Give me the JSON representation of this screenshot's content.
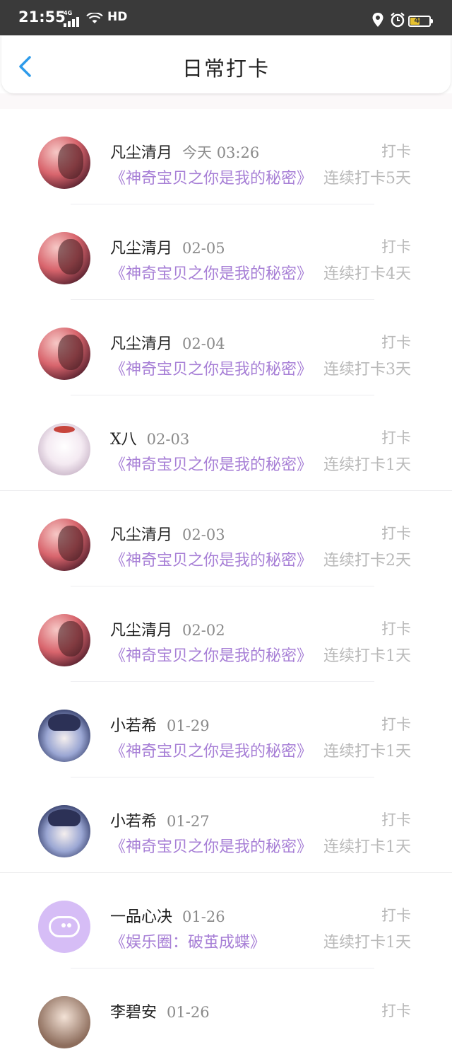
{
  "status_bar": {
    "time": "21:55",
    "network": "4G",
    "network_label": "HD",
    "battery": "47"
  },
  "header": {
    "title": "日常打卡"
  },
  "checkins": [
    {
      "user": "凡尘清月",
      "date": "今天 03:26",
      "action": "打卡",
      "topic": "《神奇宝贝之你是我的秘密》",
      "streak": "连续打卡5天"
    },
    {
      "user": "凡尘清月",
      "date": "02-05",
      "action": "打卡",
      "topic": "《神奇宝贝之你是我的秘密》",
      "streak": "连续打卡4天"
    },
    {
      "user": "凡尘清月",
      "date": "02-04",
      "action": "打卡",
      "topic": "《神奇宝贝之你是我的秘密》",
      "streak": "连续打卡3天"
    },
    {
      "user": "X八",
      "date": "02-03",
      "action": "打卡",
      "topic": "《神奇宝贝之你是我的秘密》",
      "streak": "连续打卡1天"
    },
    {
      "user": "凡尘清月",
      "date": "02-03",
      "action": "打卡",
      "topic": "《神奇宝贝之你是我的秘密》",
      "streak": "连续打卡2天"
    },
    {
      "user": "凡尘清月",
      "date": "02-02",
      "action": "打卡",
      "topic": "《神奇宝贝之你是我的秘密》",
      "streak": "连续打卡1天"
    },
    {
      "user": "小若希",
      "date": "01-29",
      "action": "打卡",
      "topic": "《神奇宝贝之你是我的秘密》",
      "streak": "连续打卡1天"
    },
    {
      "user": "小若希",
      "date": "01-27",
      "action": "打卡",
      "topic": "《神奇宝贝之你是我的秘密》",
      "streak": "连续打卡1天"
    },
    {
      "user": "一品心决",
      "date": "01-26",
      "action": "打卡",
      "topic": "《娱乐圈：破茧成蝶》",
      "streak": "连续打卡1天"
    },
    {
      "user": "李碧安",
      "date": "01-26",
      "action": "打卡",
      "topic": "",
      "streak": ""
    }
  ],
  "colors": {
    "topic": "#a77fd6",
    "back_arrow": "#2e9bea",
    "status_bar": "#3a3a3a"
  }
}
